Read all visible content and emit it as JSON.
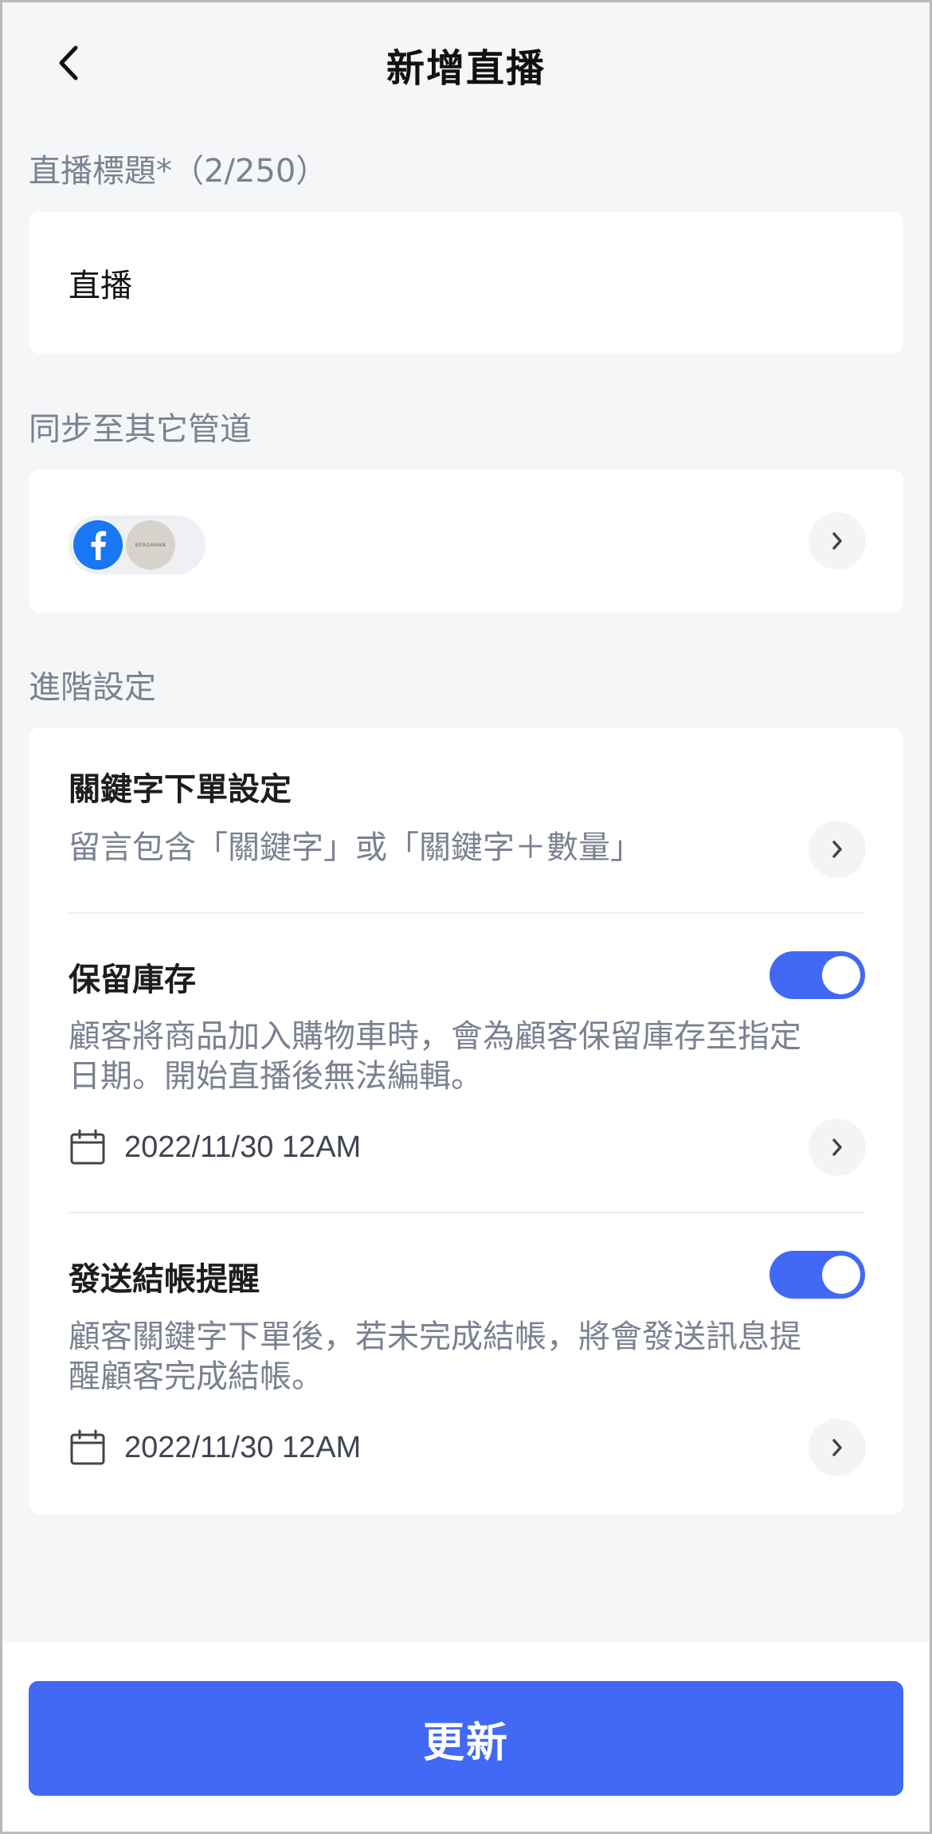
{
  "header": {
    "title": "新增直播"
  },
  "title_field": {
    "label": "直播標題*（2/250）",
    "value": "直播"
  },
  "channels": {
    "label": "同步至其它管道",
    "brand_avatar_text": "BERGAMAN"
  },
  "advanced": {
    "label": "進階設定",
    "keyword_order": {
      "title": "關鍵字下單設定",
      "description": "留言包含「關鍵字」或「關鍵字＋數量」"
    },
    "reserve_stock": {
      "title": "保留庫存",
      "enabled": true,
      "description_line1": "顧客將商品加入購物車時，會為顧客保留庫存至指定",
      "description_line2": "日期。開始直播後無法編輯。",
      "date": "2022/11/30 12AM"
    },
    "checkout_reminder": {
      "title": "發送結帳提醒",
      "enabled": true,
      "description_line1": "顧客關鍵字下單後，若未完成結帳，將會發送訊息提",
      "description_line2": "醒顧客完成結帳。",
      "date": "2022/11/30 12AM"
    }
  },
  "footer": {
    "submit_label": "更新"
  },
  "colors": {
    "accent": "#4169f5",
    "background": "#f5f6f8",
    "muted_text": "#7b8190",
    "facebook": "#1877f2"
  },
  "icons": [
    "back-chevron-icon",
    "facebook-icon",
    "chevron-right-icon",
    "calendar-icon"
  ]
}
